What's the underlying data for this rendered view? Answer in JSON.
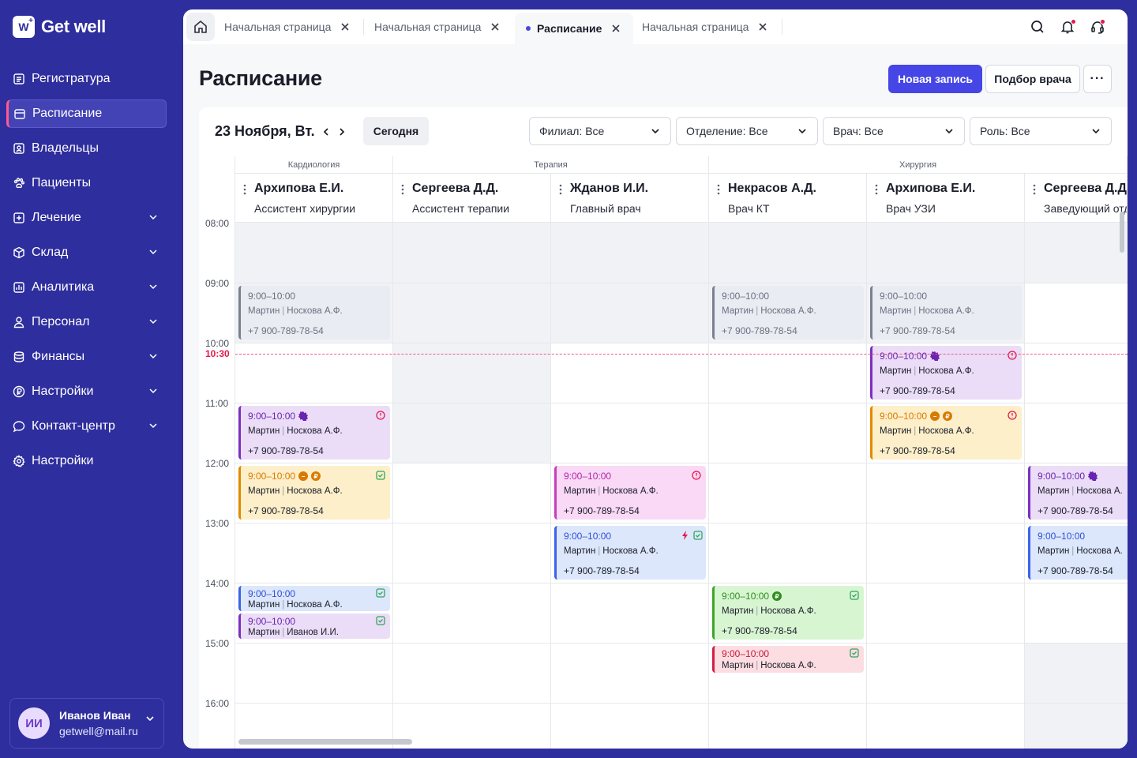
{
  "app": {
    "name": "Get well",
    "logo_mark": "W"
  },
  "sidebar": {
    "items": [
      {
        "label": "Регистратура",
        "icon": "registry-icon",
        "chevron": false
      },
      {
        "label": "Расписание",
        "icon": "calendar-icon",
        "chevron": false,
        "active": true
      },
      {
        "label": "Владельцы",
        "icon": "owners-icon",
        "chevron": false
      },
      {
        "label": "Пациенты",
        "icon": "paw-icon",
        "chevron": false
      },
      {
        "label": "Лечение",
        "icon": "plus-square-icon",
        "chevron": true
      },
      {
        "label": "Склад",
        "icon": "box-icon",
        "chevron": true
      },
      {
        "label": "Аналитика",
        "icon": "chart-icon",
        "chevron": true
      },
      {
        "label": "Персонал",
        "icon": "person-icon",
        "chevron": true
      },
      {
        "label": "Финансы",
        "icon": "coins-icon",
        "chevron": true
      },
      {
        "label": "Настройки",
        "icon": "ruble-icon",
        "chevron": true
      },
      {
        "label": "Контакт-центр",
        "icon": "chat-icon",
        "chevron": true
      },
      {
        "label": "Настройки",
        "icon": "gear-icon",
        "chevron": false
      }
    ],
    "user": {
      "initials": "ИИ",
      "name": "Иванов Иван",
      "email": "getwell@mail.ru"
    }
  },
  "tabs": [
    {
      "label": "Начальная страница",
      "active": false
    },
    {
      "label": "Начальная страница",
      "active": false
    },
    {
      "label": "Расписание",
      "active": true
    },
    {
      "label": "Начальная страница",
      "active": false
    }
  ],
  "header": {
    "title": "Расписание",
    "new_button": "Новая запись",
    "pick_button": "Подбор врача",
    "more": "···"
  },
  "toolbar": {
    "date": "23 Ноября, Вт.",
    "today": "Сегодня",
    "filters": [
      "Филиал: Все",
      "Отделение: Все",
      "Врач: Все",
      "Роль: Все"
    ]
  },
  "schedule": {
    "times": [
      "08:00",
      "09:00",
      "10:00",
      "11:00",
      "12:00",
      "13:00",
      "14:00",
      "15:00",
      "16:00"
    ],
    "now": "10:30",
    "departments": [
      "Кардиология",
      "Терапия",
      "Хирургия"
    ],
    "doctors": [
      {
        "name": "Архипова Е.И.",
        "role": "Ассистент хирургии"
      },
      {
        "name": "Сергеева Д.Д.",
        "role": "Ассистент терапии"
      },
      {
        "name": "Жданов И.И.",
        "role": "Главный врач"
      },
      {
        "name": "Некрасов А.Д.",
        "role": "Врач КТ"
      },
      {
        "name": "Архипова Е.И.",
        "role": "Врач УЗИ"
      },
      {
        "name": "Сергеева Д.Д.",
        "role": "Заведующий отделением"
      }
    ],
    "appointments": [
      {
        "time": "9:00–10:00",
        "patient": "Мартин",
        "owner": "Носкова А.Ф.",
        "phone": "+7 900-789-78-54"
      },
      {
        "time": "9:00–10:00",
        "patient": "Мартин",
        "owner": "Носкова А.Ф.",
        "phone": "+7 900-789-78-54"
      },
      {
        "time": "9:00–10:00",
        "patient": "Мартин",
        "owner": "Носкова А.Ф.",
        "phone": "+7 900-789-78-54"
      },
      {
        "time": "9:00–10:00",
        "patient": "Мартин",
        "owner": "Носкова А.Ф.",
        "phone": "+7 900-789-78-54"
      },
      {
        "time": "9:00–10:00",
        "patient": "Мартин",
        "owner": "Носкова А.Ф.",
        "phone": "+7 900-789-78-54"
      },
      {
        "time": "9:00–10:00",
        "patient": "Мартин",
        "owner": "Носкова А.Ф.",
        "phone": "+7 900-789-78-54"
      },
      {
        "time": "9:00–10:00",
        "patient": "Мартин",
        "owner": "Носкова А.Ф.",
        "phone": "+7 900-789-78-54"
      },
      {
        "time": "9:00–10:00",
        "patient": "Мартин",
        "owner": "Носкова А.Ф.",
        "phone": "+7 900-789-78-54"
      },
      {
        "time": "9:00–10:00",
        "patient": "Мартин",
        "owner": "Носкова А.Ф.",
        "phone": "+7 900-789-78-54"
      },
      {
        "time": "9:00–10:00",
        "patient": "Мартин",
        "owner": "Носкова А.Ф.",
        "phone": ""
      },
      {
        "time": "9:00–10:00",
        "patient": "Мартин",
        "owner": "Иванов И.И.",
        "phone": ""
      },
      {
        "time": "9:00–10:00",
        "patient": "Мартин",
        "owner": "Носкова А.Ф.",
        "phone": "+7 900-789-78-54"
      },
      {
        "time": "9:00–10:00",
        "patient": "Мартин",
        "owner": "Носкова А.Ф.",
        "phone": ""
      },
      {
        "time": "9:00–10:00",
        "patient": "Мартин",
        "owner": "Носкова А.",
        "phone": "+7 900-789-78-54"
      },
      {
        "time": "9:00–10:00",
        "patient": "Мартин",
        "owner": "Носкова А.",
        "phone": "+7 900-789-78-54"
      }
    ]
  },
  "colors": {
    "sidebar": "#2E2E9E",
    "primary": "#4646E6",
    "now_line": "#E5194B"
  }
}
